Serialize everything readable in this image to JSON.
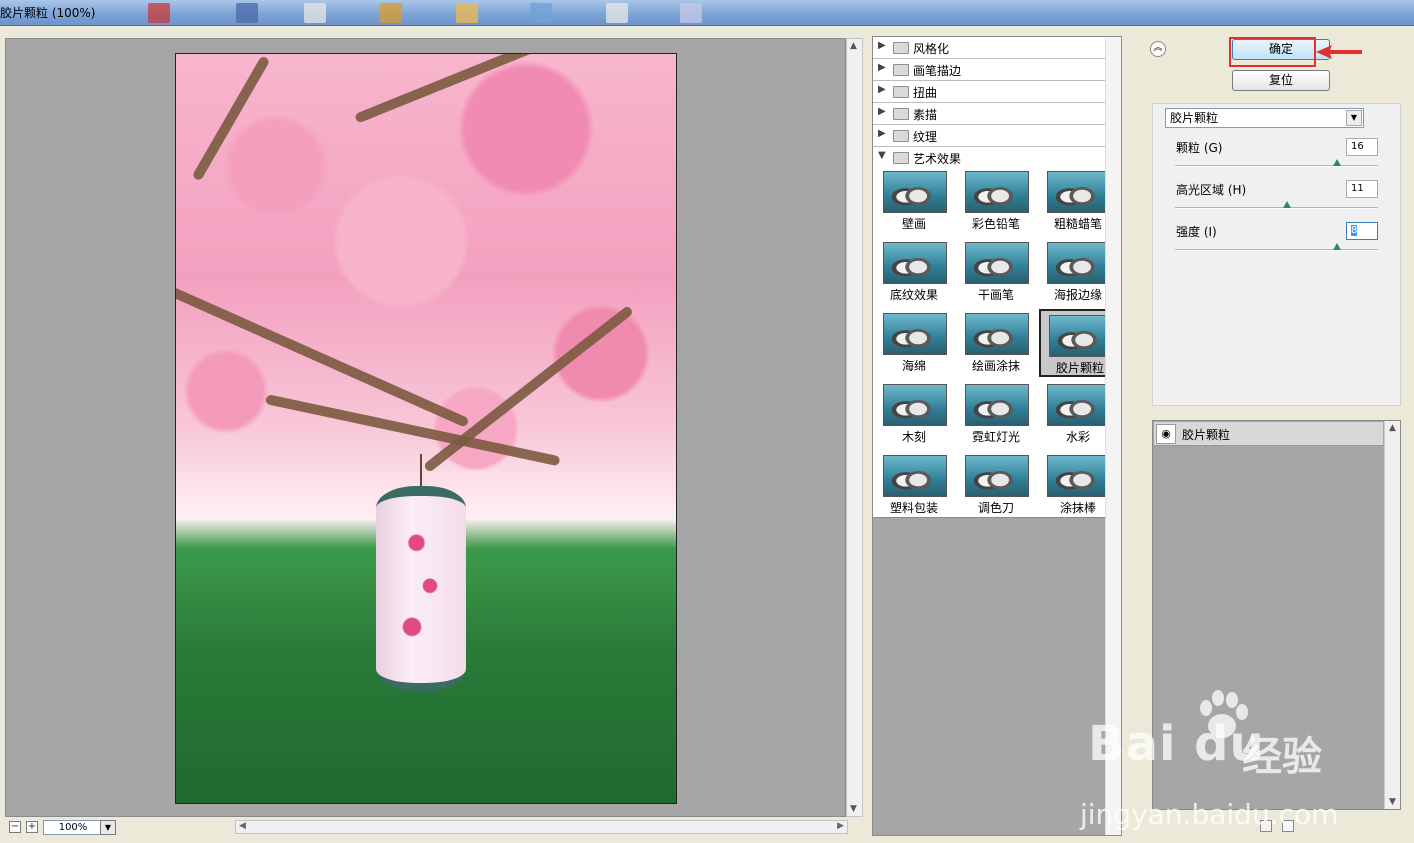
{
  "window": {
    "title": "胶片颗粒 (100%)"
  },
  "preview": {
    "zoom": "100%"
  },
  "filter_browser": {
    "categories": [
      {
        "label": "风格化",
        "expanded": false
      },
      {
        "label": "画笔描边",
        "expanded": false
      },
      {
        "label": "扭曲",
        "expanded": false
      },
      {
        "label": "素描",
        "expanded": false
      },
      {
        "label": "纹理",
        "expanded": false
      },
      {
        "label": "艺术效果",
        "expanded": true
      }
    ],
    "artistic_filters": [
      "壁画",
      "彩色铅笔",
      "粗糙蜡笔",
      "底纹效果",
      "干画笔",
      "海报边缘",
      "海绵",
      "绘画涂抹",
      "胶片颗粒",
      "木刻",
      "霓虹灯光",
      "水彩",
      "塑料包装",
      "调色刀",
      "涂抹棒"
    ],
    "selected": "胶片颗粒"
  },
  "buttons": {
    "ok": "确定",
    "reset": "复位"
  },
  "settings": {
    "filter_select": "胶片颗粒",
    "params": [
      {
        "label": "颗粒 (G)",
        "value": "16",
        "level": 0.8
      },
      {
        "label": "高光区域 (H)",
        "value": "11",
        "level": 0.55
      },
      {
        "label": "强度 (I)",
        "value": "8",
        "level": 0.8
      }
    ]
  },
  "layers": {
    "items": [
      {
        "name": "胶片颗粒"
      }
    ]
  },
  "watermark": {
    "brand": "Bai du",
    "cn": "经验",
    "url": "jingyan.baidu.com"
  },
  "colors": {
    "ok_highlight": "#e03030",
    "button_blue": "#3c7fb1",
    "preview_bg": "#a6a6a6"
  }
}
